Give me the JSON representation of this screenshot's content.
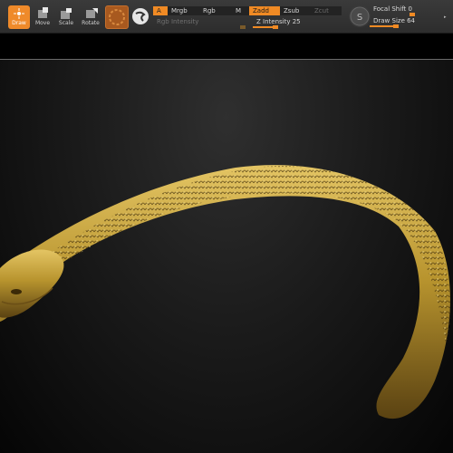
{
  "toolbar": {
    "buttons": [
      {
        "label": "Draw",
        "icon": "draw-icon",
        "active": true
      },
      {
        "label": "Move",
        "icon": "move-icon",
        "active": false
      },
      {
        "label": "Scale",
        "icon": "scale-icon",
        "active": false
      },
      {
        "label": "Rotate",
        "icon": "rotate-icon",
        "active": false
      }
    ],
    "segments": {
      "a": "A",
      "mrgb": "Mrgb",
      "rgb": "Rgb",
      "m": "M",
      "zadd": "Zadd",
      "zsub": "Zsub",
      "zcut": "Zcut"
    },
    "rgb_intensity_label": "Rgb Intensity",
    "z_intensity_label": "Z Intensity 25",
    "z_intensity_value": 25,
    "focal_shift_label": "Focal Shift 0",
    "focal_shift_value": 0,
    "draw_size_label": "Draw Size 64",
    "draw_size_value": 64,
    "colors": {
      "accent": "#f08a24",
      "sculpt": "#b8942e"
    }
  }
}
